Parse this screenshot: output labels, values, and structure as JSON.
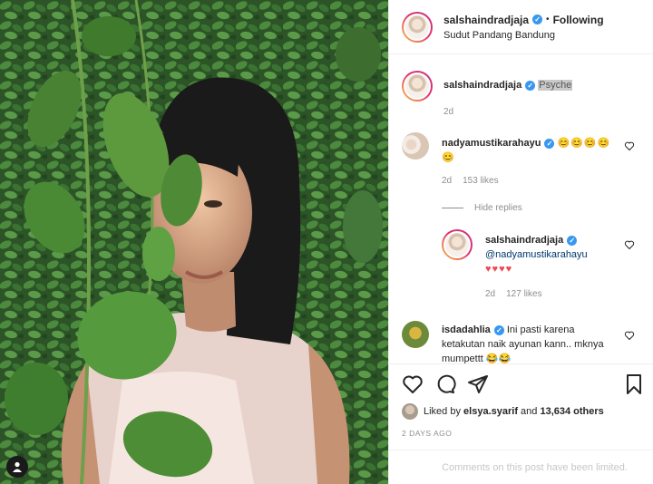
{
  "post": {
    "username": "salshaindradjaja",
    "following_label": "Following",
    "location": "Sudut Pandang Bandung"
  },
  "caption": {
    "username": "salshaindradjaja",
    "text": "Psyche",
    "time": "2d"
  },
  "comments": [
    {
      "username": "nadyamustikarahayu",
      "text": "😊😊😊😊😊",
      "time": "2d",
      "likes": "153 likes"
    },
    {
      "username": "salshaindradjaja",
      "mention": "@nadyamustikarahayu",
      "text": "♥♥♥♥",
      "time": "2d",
      "likes": "127 likes"
    },
    {
      "username": "isdadahlia",
      "text": "Ini pasti karena ketakutan naik ayunan kann.. mknya mumpettt 😂😂"
    }
  ],
  "hide_replies_label": "Hide replies",
  "liked_by": {
    "prefix": "Liked by",
    "user": "elsya.syarif",
    "and": "and",
    "count": "13,634 others"
  },
  "timestamp": "2 DAYS AGO",
  "comments_limited": "Comments on this post have been limited.",
  "colors": {
    "verified": "#3897f0",
    "heart": "#ed4956",
    "muted": "#8e8e8e"
  }
}
